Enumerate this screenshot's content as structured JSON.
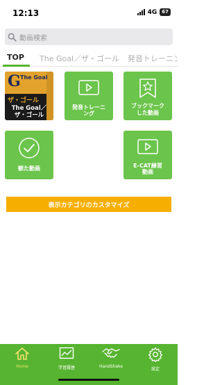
{
  "status": {
    "time": "12:13",
    "network": "4G",
    "battery": "67"
  },
  "search": {
    "placeholder": "動画検索",
    "icon": "search-icon"
  },
  "tabs": [
    {
      "label": "TOP",
      "active": true
    },
    {
      "label": "The Goal／ザ・ゴール",
      "active": false
    },
    {
      "label": "発音トレーニング",
      "active": false
    }
  ],
  "tiles": {
    "the_goal": {
      "label_line1": "The Goal／",
      "label_line2": "ザ・ゴール",
      "cover_title": "The Goal",
      "cover_jp": "ザ・ゴール"
    },
    "pronunciation": {
      "label_line1": "発音トレーニ",
      "label_line2": "ング",
      "icon": "play-icon"
    },
    "bookmarked": {
      "label_line1": "ブックマーク",
      "label_line2": "した動画",
      "icon": "bookmark-star-icon"
    },
    "watched": {
      "label": "観た動画",
      "icon": "check-circle-icon"
    },
    "ecat": {
      "label_line1": "E-CAT練習",
      "label_line2": "動画",
      "icon": "play-icon"
    }
  },
  "customize_button": {
    "label": "表示カテゴリのカスタマイズ"
  },
  "bottom_nav": [
    {
      "label": "Home",
      "icon": "home-icon",
      "active": true
    },
    {
      "label": "学習履歴",
      "icon": "chart-icon",
      "active": false
    },
    {
      "label": "HandShake",
      "icon": "handshake-icon",
      "active": false
    },
    {
      "label": "設定",
      "icon": "gear-icon",
      "active": false
    }
  ],
  "colors": {
    "primary_green": "#57b431",
    "tile_green": "#6bc44b",
    "accent_orange": "#f6ae00",
    "active_nav": "#f3e36d"
  }
}
